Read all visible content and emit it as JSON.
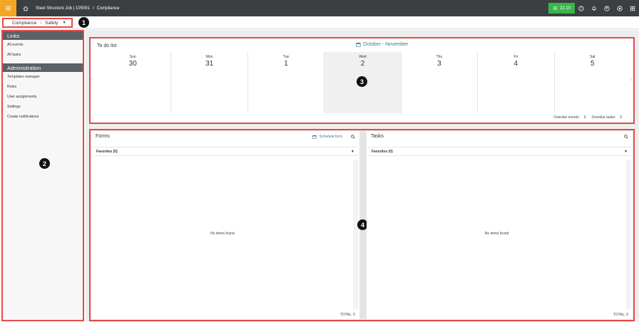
{
  "topbar": {
    "project": "Steel Structure Job | 105091",
    "separator": "/",
    "section": "Compliance",
    "time": "22.10",
    "icons": [
      "help-icon",
      "bell-icon",
      "user-icon",
      "globe-icon",
      "apps-icon"
    ],
    "accent_color": "#f5a623",
    "badge_color": "#3ab54a"
  },
  "breadcrumb": {
    "parent": "Compliance",
    "sep": ">",
    "current": "Safety"
  },
  "callouts": [
    "1",
    "2",
    "3",
    "4"
  ],
  "sidebar": {
    "links_heading": "Links",
    "links": [
      "All events",
      "All tasks"
    ],
    "admin_heading": "Administration",
    "admin_items": [
      "Templates manager",
      "Roles",
      "User assignments",
      "Settings",
      "Create notifications"
    ]
  },
  "todo": {
    "title": "To do list",
    "range": "October - November",
    "days": [
      {
        "name": "Sun",
        "num": "30"
      },
      {
        "name": "Mon",
        "num": "31"
      },
      {
        "name": "Tue",
        "num": "1"
      },
      {
        "name": "Wed",
        "num": "2"
      },
      {
        "name": "Thu",
        "num": "3"
      },
      {
        "name": "Fri",
        "num": "4"
      },
      {
        "name": "Sat",
        "num": "5"
      }
    ],
    "overdue_events_label": "Overdue events:",
    "overdue_events": "0",
    "overdue_tasks_label": "Overdue tasks:",
    "overdue_tasks": "0"
  },
  "forms": {
    "title": "Forms",
    "schedule_label": "Schedule form",
    "filter": "Favorites (0)",
    "empty": "No items found",
    "total": "TOTAL: 0"
  },
  "tasks": {
    "title": "Tasks",
    "filter": "Favorites (0)",
    "empty": "No items found",
    "total": "TOTAL: 0"
  }
}
